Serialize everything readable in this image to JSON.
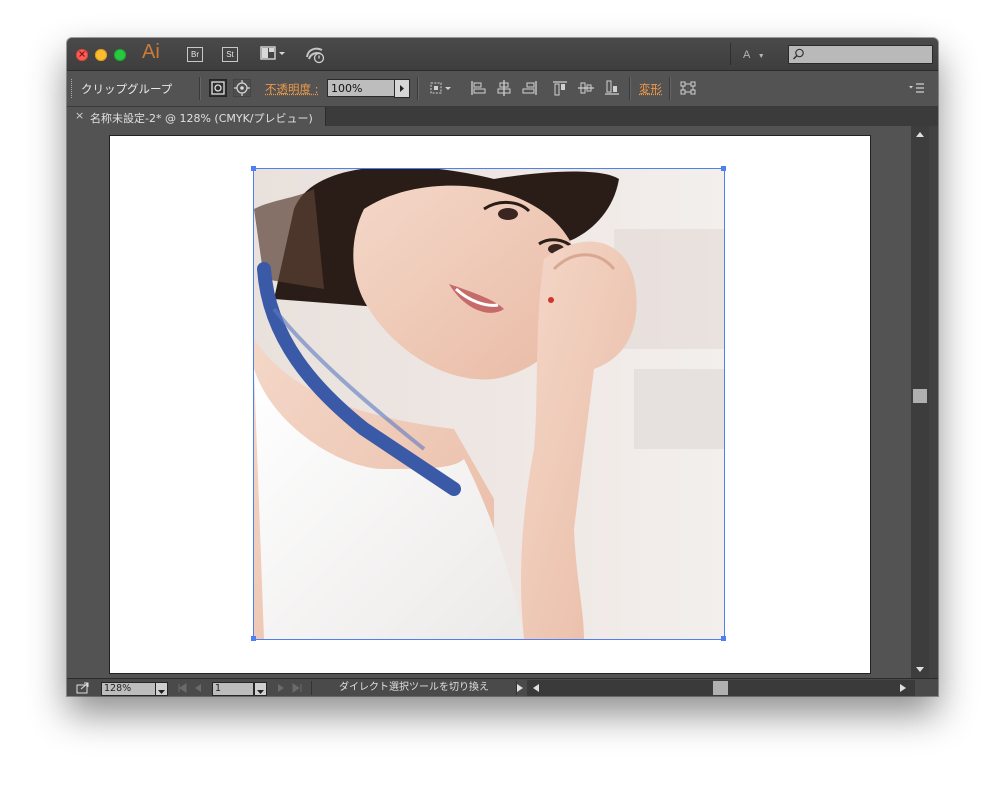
{
  "app": {
    "logo": "Ai",
    "bridge_button": "Br",
    "stock_button": "St",
    "workspace_switcher": "A"
  },
  "search": {
    "placeholder": ""
  },
  "control_bar": {
    "object_type": "クリップグループ",
    "opacity_label": "不透明度 :",
    "opacity_value": "100%",
    "transform_label": "変形"
  },
  "document_tab": {
    "close_glyph": "×",
    "title": "名称未設定-2* @ 128% (CMYK/プレビュー)"
  },
  "status_bar": {
    "zoom": "128%",
    "artboard_number": "1",
    "tool_hint": "ダイレクト選択ツールを切り換え"
  },
  "icons": [
    "export-icon",
    "workspace-layout-icon",
    "sync-icon",
    "search-icon",
    "clip-mask-icon",
    "isolate-icon",
    "align-left-icon",
    "align-center-h-icon",
    "align-right-icon",
    "align-top-icon",
    "align-center-v-icon",
    "align-bottom-icon",
    "panel-menu-icon"
  ],
  "colors": {
    "ai_logo": "#c97b3a",
    "orange_label": "#ef9a4a",
    "selection_blue": "#4f7ff0",
    "ui_gray": "#535353"
  }
}
